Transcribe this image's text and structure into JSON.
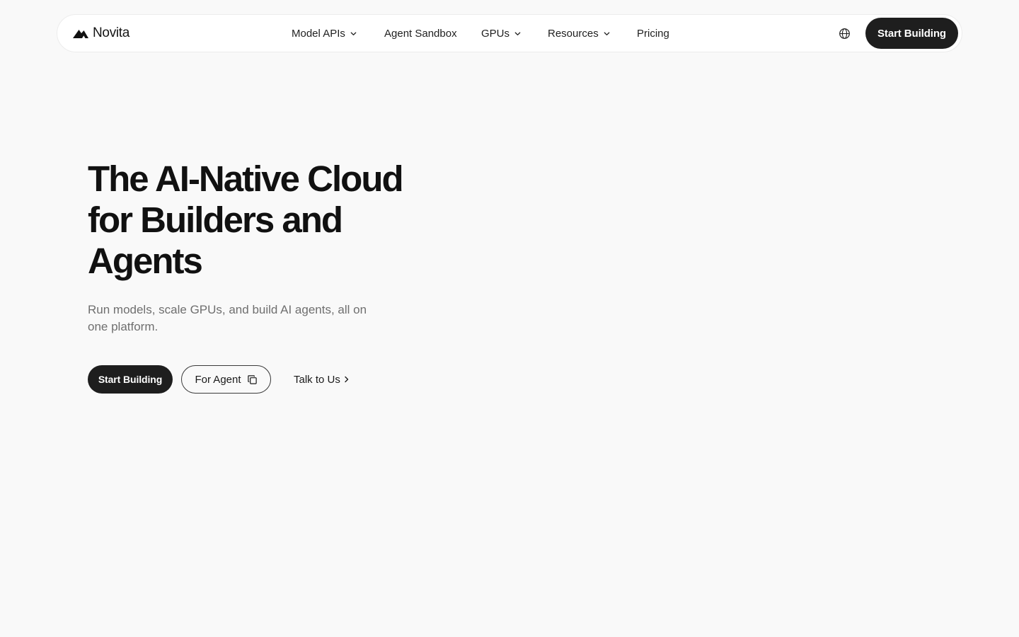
{
  "brand": {
    "name": "Novita",
    "logo_icon": "novita-peak-logo"
  },
  "nav": {
    "items": [
      {
        "label": "Model APIs",
        "has_dropdown": true
      },
      {
        "label": "Agent Sandbox",
        "has_dropdown": false
      },
      {
        "label": "GPUs",
        "has_dropdown": true
      },
      {
        "label": "Resources",
        "has_dropdown": true
      },
      {
        "label": "Pricing",
        "has_dropdown": false
      }
    ],
    "language_icon": "globe-icon",
    "cta_label": "Start Building"
  },
  "hero": {
    "title_lines": [
      "The AI-Native Cloud",
      "for Builders and",
      "Agents"
    ],
    "subtitle": "Run models, scale GPUs, and build AI agents, all on one platform.",
    "primary_label": "Start Building",
    "secondary_label": "For Agent",
    "secondary_icon": "copy-icon",
    "link_label": "Talk to Us",
    "link_icon": "chevron-right-icon"
  },
  "colors": {
    "background": "#f9f9f9",
    "surface": "#ffffff",
    "primary_button": "#1e1e1e",
    "primary_text": "#111111",
    "muted_text": "#6f6f6f"
  }
}
